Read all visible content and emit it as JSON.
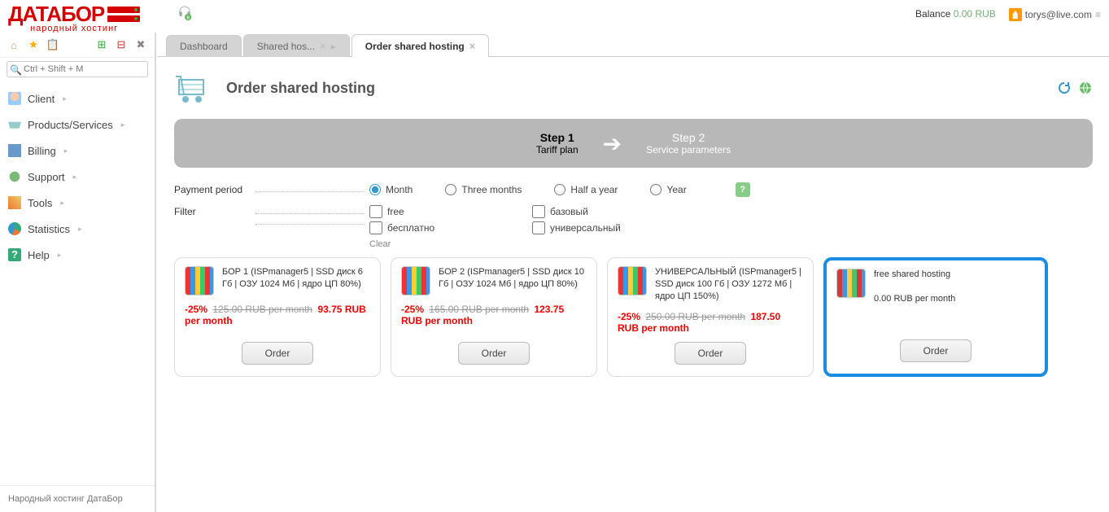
{
  "brand": {
    "name": "ДАТАБОР",
    "tagline": "народный хостинг"
  },
  "header": {
    "balance_label": "Balance",
    "balance_value": "0.00 RUB",
    "user_email": "torys@live.com"
  },
  "support_badge_count": "0",
  "sidebar": {
    "search_placeholder": "Ctrl + Shift + M",
    "items": [
      {
        "label": "Client"
      },
      {
        "label": "Products/Services"
      },
      {
        "label": "Billing"
      },
      {
        "label": "Support"
      },
      {
        "label": "Tools"
      },
      {
        "label": "Statistics"
      },
      {
        "label": "Help"
      }
    ],
    "footer": "Народный хостинг ДатаБор"
  },
  "tabs": [
    {
      "label": "Dashboard",
      "closable": false
    },
    {
      "label": "Shared hos...",
      "closable": true
    },
    {
      "label": "Order shared hosting",
      "closable": true,
      "active": true
    }
  ],
  "page": {
    "title": "Order shared hosting"
  },
  "steps": {
    "s1_title": "Step 1",
    "s1_sub": "Tariff plan",
    "s2_title": "Step 2",
    "s2_sub": "Service parameters"
  },
  "form": {
    "period_label": "Payment period",
    "periods": [
      "Month",
      "Three months",
      "Half a year",
      "Year"
    ],
    "filter_label": "Filter",
    "filters_col1": [
      "free",
      "бесплатно"
    ],
    "filters_col2": [
      "базовый",
      "универсальный"
    ],
    "clear": "Clear"
  },
  "plans": [
    {
      "name": "БОР 1 (ISPmanager5 | SSD диск 6 Гб | ОЗУ 1024 Мб | ядро ЦП 80%)",
      "discount": "-25%",
      "old_price": "125.00 RUB per month",
      "new_price": "93.75 RUB per month",
      "order": "Order"
    },
    {
      "name": "БОР 2 (ISPmanager5 | SSD диск 10 Гб | ОЗУ 1024 Мб | ядро ЦП 80%)",
      "discount": "-25%",
      "old_price": "165.00 RUB per month",
      "new_price": "123.75 RUB per month",
      "order": "Order"
    },
    {
      "name": "УНИВЕРСАЛЬНЫЙ (ISPmanager5 | SSD диск 100 Гб | ОЗУ 1272 Мб | ядро ЦП 150%)",
      "discount": "-25%",
      "old_price": "250.00 RUB per month",
      "new_price": "187.50 RUB per month",
      "order": "Order"
    },
    {
      "name": "free shared hosting",
      "sub": "0.00 RUB per month",
      "order": "Order",
      "highlight": true
    }
  ]
}
